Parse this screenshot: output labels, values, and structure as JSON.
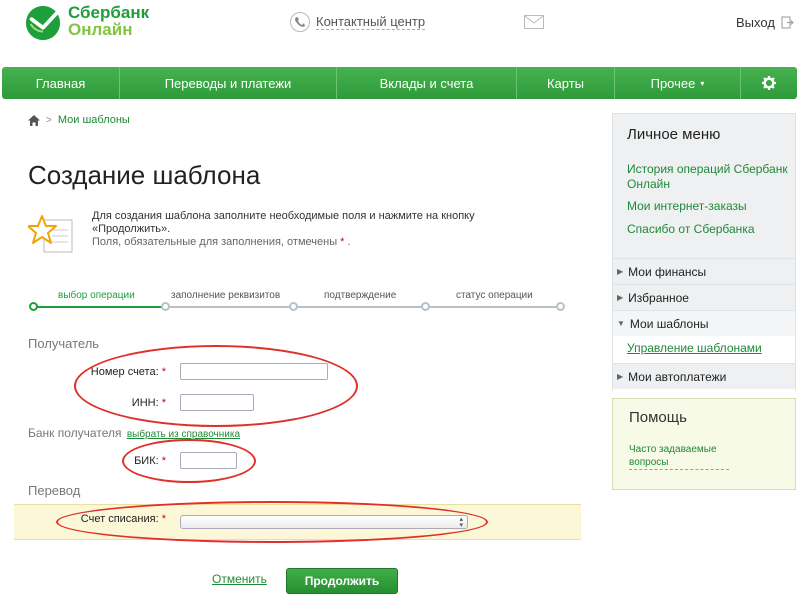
{
  "header": {
    "logo_line1": "Сбербанк",
    "logo_line2": "Онлайн",
    "contact_label": "Контактный центр",
    "logout_label": "Выход"
  },
  "nav": {
    "items": [
      {
        "label": "Главная"
      },
      {
        "label": "Переводы и платежи"
      },
      {
        "label": "Вклады и счета"
      },
      {
        "label": "Карты"
      },
      {
        "label": "Прочее"
      }
    ]
  },
  "breadcrumb": {
    "current": "Мои шаблоны"
  },
  "page": {
    "title": "Создание шаблона",
    "notice_text": "Для создания шаблона заполните необходимые поля и нажмите на кнопку «Продолжить».",
    "notice_required": "Поля, обязательные для заполнения, отмечены",
    "required_mark": "*"
  },
  "steps": [
    {
      "label": "выбор операции",
      "active": true
    },
    {
      "label": "заполнение реквизитов",
      "active": false
    },
    {
      "label": "подтверждение",
      "active": false
    },
    {
      "label": "статус операции",
      "active": false
    }
  ],
  "form": {
    "recipient_title": "Получатель",
    "account_label": "Номер счета:",
    "account_value": "",
    "inn_label": "ИНН:",
    "inn_value": "",
    "bank_title": "Банк получателя",
    "bank_directory_link": "выбрать из справочника",
    "bik_label": "БИК:",
    "bik_value": "",
    "transfer_title": "Перевод",
    "debit_account_label": "Счет списания:",
    "debit_account_value": "",
    "cancel_label": "Отменить",
    "continue_label": "Продолжить"
  },
  "sidebar": {
    "title": "Личное меню",
    "links": [
      {
        "label": "История операций Сбербанк Онлайн"
      },
      {
        "label": "Мои интернет-заказы"
      },
      {
        "label": "Спасибо от Сбербанка"
      }
    ],
    "sections": [
      {
        "label": "Мои финансы"
      },
      {
        "label": "Избранное"
      },
      {
        "label": "Мои шаблоны"
      },
      {
        "label": "Мои автоплатежи"
      }
    ],
    "templates_sublink": "Управление шаблонами"
  },
  "help": {
    "title": "Помощь",
    "faq_link": "Часто задаваемые вопросы"
  },
  "colors": {
    "brand_green": "#1e9f3c",
    "nav_green": "#3aa844",
    "required_red": "#d0021b",
    "annotation_red": "#e0302a"
  }
}
